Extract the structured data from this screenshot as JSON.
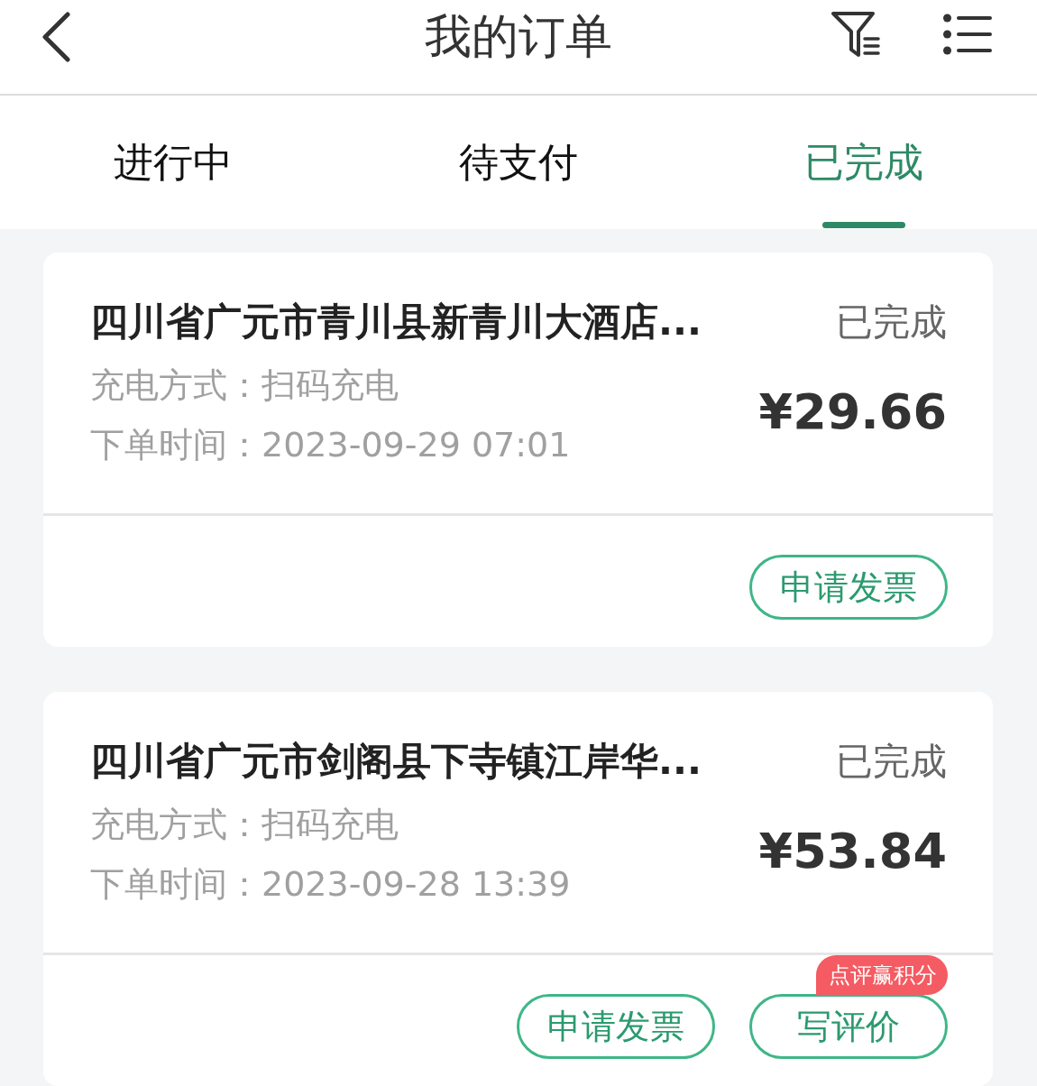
{
  "header": {
    "title": "我的订单"
  },
  "tabs": [
    {
      "label": "进行中",
      "selected": false
    },
    {
      "label": "待支付",
      "selected": false
    },
    {
      "label": "已完成",
      "selected": true
    }
  ],
  "orders": [
    {
      "station": "四川省广元市青川县新青川大酒店...",
      "status": "已完成",
      "price": "¥29.66",
      "details": [
        "充电方式：扫码充电",
        "下单时间：2023-09-29 07:01"
      ],
      "actions": [
        {
          "label": "申请发票"
        }
      ]
    },
    {
      "station": "四川省广元市剑阁县下寺镇江岸华...",
      "status": "已完成",
      "price": "¥53.84",
      "details": [
        "充电方式：扫码充电",
        "下单时间：2023-09-28 13:39"
      ],
      "actions": [
        {
          "label": "申请发票"
        },
        {
          "label": "写评价",
          "badge": "点评赢积分"
        }
      ]
    }
  ]
}
